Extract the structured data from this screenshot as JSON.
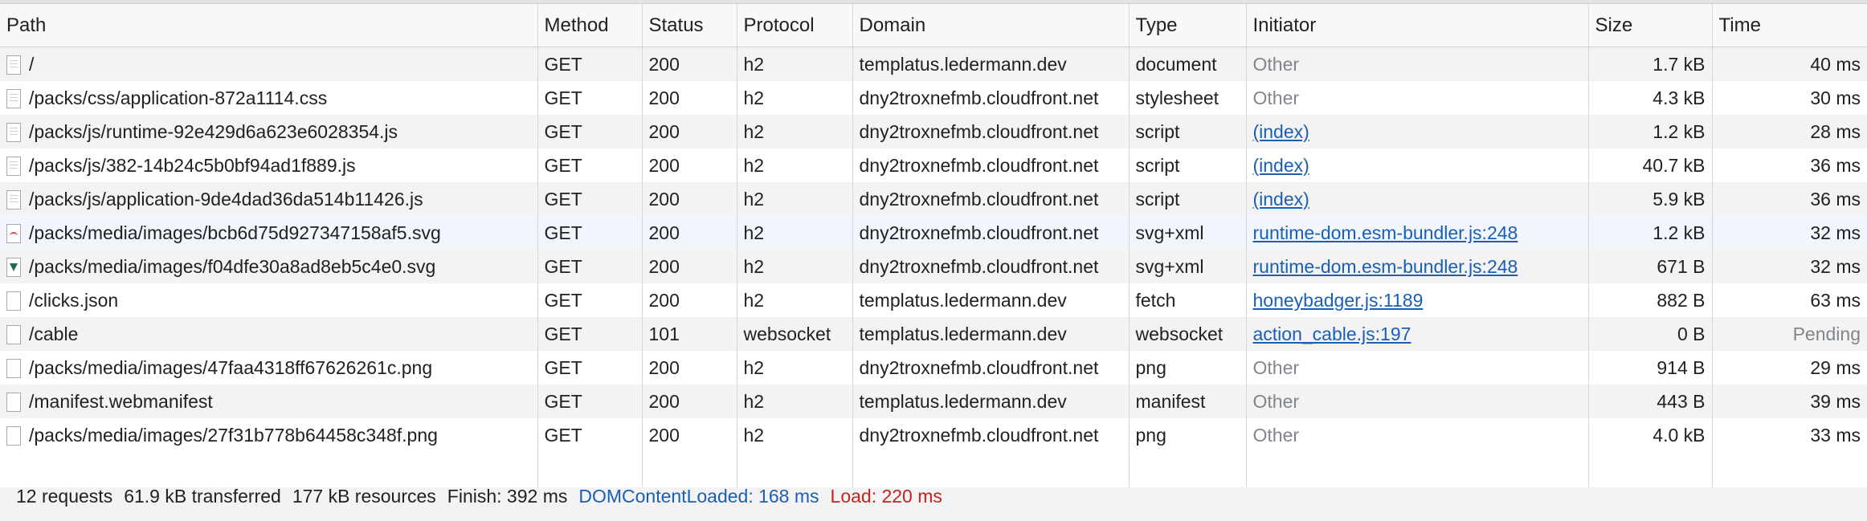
{
  "columns": {
    "path": "Path",
    "method": "Method",
    "status": "Status",
    "protocol": "Protocol",
    "domain": "Domain",
    "type": "Type",
    "initiator": "Initiator",
    "size": "Size",
    "time": "Time"
  },
  "rows": [
    {
      "path": "/",
      "method": "GET",
      "status": "200",
      "protocol": "h2",
      "domain": "templatus.ledermann.dev",
      "type": "document",
      "initiator": "Other",
      "size": "1.7 kB",
      "time": "40 ms"
    },
    {
      "path": "/packs/css/application-872a1114.css",
      "method": "GET",
      "status": "200",
      "protocol": "h2",
      "domain": "dny2troxnefmb.cloudfront.net",
      "type": "stylesheet",
      "initiator": "Other",
      "size": "4.3 kB",
      "time": "30 ms"
    },
    {
      "path": "/packs/js/runtime-92e429d6a623e6028354.js",
      "method": "GET",
      "status": "200",
      "protocol": "h2",
      "domain": "dny2troxnefmb.cloudfront.net",
      "type": "script",
      "initiator": "(index)",
      "size": "1.2 kB",
      "time": "28 ms"
    },
    {
      "path": "/packs/js/382-14b24c5b0bf94ad1f889.js",
      "method": "GET",
      "status": "200",
      "protocol": "h2",
      "domain": "dny2troxnefmb.cloudfront.net",
      "type": "script",
      "initiator": "(index)",
      "size": "40.7 kB",
      "time": "36 ms"
    },
    {
      "path": "/packs/js/application-9de4dad36da514b11426.js",
      "method": "GET",
      "status": "200",
      "protocol": "h2",
      "domain": "dny2troxnefmb.cloudfront.net",
      "type": "script",
      "initiator": "(index)",
      "size": "5.9 kB",
      "time": "36 ms"
    },
    {
      "path": "/packs/media/images/bcb6d75d927347158af5.svg",
      "method": "GET",
      "status": "200",
      "protocol": "h2",
      "domain": "dny2troxnefmb.cloudfront.net",
      "type": "svg+xml",
      "initiator": "runtime-dom.esm-bundler.js:248",
      "size": "1.2 kB",
      "time": "32 ms"
    },
    {
      "path": "/packs/media/images/f04dfe30a8ad8eb5c4e0.svg",
      "method": "GET",
      "status": "200",
      "protocol": "h2",
      "domain": "dny2troxnefmb.cloudfront.net",
      "type": "svg+xml",
      "initiator": "runtime-dom.esm-bundler.js:248",
      "size": "671 B",
      "time": "32 ms"
    },
    {
      "path": "/clicks.json",
      "method": "GET",
      "status": "200",
      "protocol": "h2",
      "domain": "templatus.ledermann.dev",
      "type": "fetch",
      "initiator": "honeybadger.js:1189",
      "size": "882 B",
      "time": "63 ms"
    },
    {
      "path": "/cable",
      "method": "GET",
      "status": "101",
      "protocol": "websocket",
      "domain": "templatus.ledermann.dev",
      "type": "websocket",
      "initiator": "action_cable.js:197",
      "size": "0 B",
      "time": "Pending"
    },
    {
      "path": "/packs/media/images/47faa4318ff67626261c.png",
      "method": "GET",
      "status": "200",
      "protocol": "h2",
      "domain": "dny2troxnefmb.cloudfront.net",
      "type": "png",
      "initiator": "Other",
      "size": "914 B",
      "time": "29 ms"
    },
    {
      "path": "/manifest.webmanifest",
      "method": "GET",
      "status": "200",
      "protocol": "h2",
      "domain": "templatus.ledermann.dev",
      "type": "manifest",
      "initiator": "Other",
      "size": "443 B",
      "time": "39 ms"
    },
    {
      "path": "/packs/media/images/27f31b778b64458c348f.png",
      "method": "GET",
      "status": "200",
      "protocol": "h2",
      "domain": "dny2troxnefmb.cloudfront.net",
      "type": "png",
      "initiator": "Other",
      "size": "4.0 kB",
      "time": "33 ms"
    }
  ],
  "summary": {
    "requests": "12 requests",
    "transferred": "61.9 kB transferred",
    "resources": "177 kB resources",
    "finish": "Finish: 392 ms",
    "dom_content_loaded": "DOMContentLoaded: 168 ms",
    "load": "Load: 220 ms"
  },
  "colors": {
    "link": "#1a5fb4",
    "dom_content_loaded": "#1a5fb4",
    "load": "#c5221f",
    "muted": "#80868b"
  }
}
